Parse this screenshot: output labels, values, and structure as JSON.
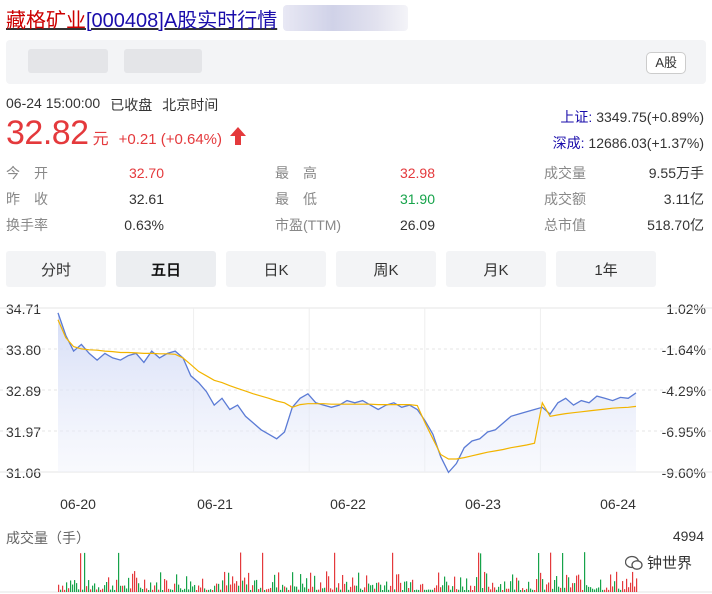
{
  "header": {
    "stock_name": "藏格矿业",
    "rest": "[000408]A股实时行情",
    "market_tag": "A股"
  },
  "quote": {
    "datetime": "06-24 15:00:00",
    "status": "已收盘",
    "timezone": "北京时间",
    "price": "32.82",
    "unit": "元",
    "change": "+0.21 (+0.64%)"
  },
  "indices": [
    {
      "name": "上证:",
      "value": "3349.75(+0.89%)"
    },
    {
      "name": "深成:",
      "value": "12686.03(+1.37%)"
    }
  ],
  "stats": {
    "col1": [
      {
        "label": "今　开",
        "value": "32.70",
        "color": "red"
      },
      {
        "label": "昨　收",
        "value": "32.61",
        "color": "normal"
      },
      {
        "label": "换手率",
        "value": "0.63%",
        "color": "normal"
      }
    ],
    "col2": [
      {
        "label": "最　高",
        "value": "32.98",
        "color": "red"
      },
      {
        "label": "最　低",
        "value": "31.90",
        "color": "green"
      },
      {
        "label": "市盈(TTM)",
        "value": "26.09",
        "color": "normal"
      }
    ],
    "col3": [
      {
        "label": "成交量",
        "value": "9.55万手",
        "color": "normal"
      },
      {
        "label": "成交额",
        "value": "3.11亿",
        "color": "normal"
      },
      {
        "label": "总市值",
        "value": "518.70亿",
        "color": "normal"
      }
    ]
  },
  "tabs": [
    "分时",
    "五日",
    "日K",
    "周K",
    "月K",
    "1年"
  ],
  "active_tab": "五日",
  "chart_data": {
    "type": "line",
    "x_labels": [
      "06-20",
      "06-21",
      "06-22",
      "06-23",
      "06-24"
    ],
    "y_left_ticks": [
      "34.71",
      "33.80",
      "32.89",
      "31.97",
      "31.06"
    ],
    "y_right_ticks": [
      "1.02%",
      "-1.64%",
      "-4.29%",
      "-6.95%",
      "-9.60%"
    ],
    "ylim": [
      31.06,
      34.71
    ],
    "series": [
      {
        "values": [
          34.6,
          34.1,
          33.75,
          33.9,
          33.7,
          33.55,
          33.7,
          33.6,
          33.55,
          33.65,
          33.7,
          33.5,
          33.75,
          33.6,
          33.7,
          33.75,
          33.6,
          33.2,
          33.05,
          32.85,
          32.55,
          32.7,
          32.45,
          32.55,
          32.3,
          32.15,
          32.0,
          31.9,
          31.8,
          31.95,
          32.5,
          32.7,
          32.8,
          32.6,
          32.55,
          32.5,
          32.55,
          32.65,
          32.6,
          32.65,
          32.55,
          32.45,
          32.55,
          32.6,
          32.5,
          32.55,
          32.45,
          32.2,
          31.9,
          31.4,
          31.05,
          31.25,
          31.6,
          31.75,
          31.8,
          31.95,
          32.0,
          32.15,
          32.3,
          32.35,
          32.4,
          32.45,
          32.5,
          32.35,
          32.6,
          32.7,
          32.55,
          32.65,
          32.6,
          32.75,
          32.7,
          32.65,
          32.72,
          32.7,
          32.82
        ],
        "color": "#5b7bd5"
      },
      {
        "values": [
          34.45,
          34.05,
          33.85,
          33.8,
          33.78,
          33.77,
          33.75,
          33.74,
          33.72,
          33.72,
          33.71,
          33.7,
          33.7,
          33.69,
          33.69,
          33.68,
          33.6,
          33.45,
          33.3,
          33.2,
          33.1,
          33.05,
          32.98,
          32.92,
          32.86,
          32.8,
          32.75,
          32.7,
          32.64,
          32.6,
          32.5,
          32.56,
          32.58,
          32.58,
          32.58,
          32.57,
          32.57,
          32.57,
          32.57,
          32.57,
          32.57,
          32.56,
          32.56,
          32.56,
          32.56,
          32.56,
          32.54,
          32.15,
          31.8,
          31.45,
          31.35,
          31.35,
          31.38,
          31.42,
          31.46,
          31.5,
          31.53,
          31.56,
          31.6,
          31.63,
          31.66,
          31.7,
          32.6,
          32.3,
          32.33,
          32.36,
          32.38,
          32.4,
          32.42,
          32.44,
          32.46,
          32.48,
          32.49,
          32.5,
          32.52
        ],
        "color": "#f2b400"
      }
    ],
    "volume_max": "4994",
    "volume_label": "成交量（手）"
  },
  "watermark": "钟世界",
  "colors": {
    "up": "#e4393c",
    "down": "#16a34a",
    "link": "#1a0dab",
    "price_line": "#5b7bd5",
    "avg_line": "#f2b400"
  }
}
